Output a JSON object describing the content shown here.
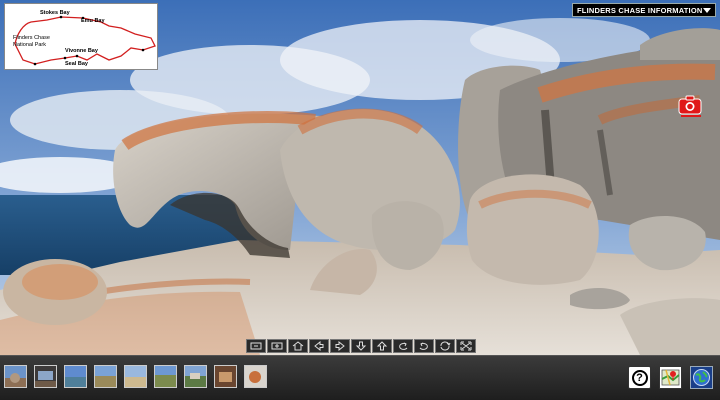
{
  "info_dropdown": {
    "label": "FLINDERS CHASE INFORMATION"
  },
  "minimap": {
    "labels": {
      "stokes_bay": "Stokes Bay",
      "emu_bay": "Emu Bay",
      "park_line1": "Flinders Chase",
      "park_line2": "National Park",
      "vivonne_bay": "Vivonne Bay",
      "seal_bay": "Seal Bay"
    }
  },
  "navbar": {
    "buttons": [
      "zoom-out",
      "zoom-in",
      "home",
      "pan-left",
      "pan-right",
      "pan-down",
      "pan-up",
      "rotate-left",
      "rotate-right",
      "autorotate",
      "fullscreen"
    ]
  },
  "thumbnails": {
    "count": 9
  },
  "right_buttons": {
    "help": "?"
  },
  "colors": {
    "sky": "#4a7fc4",
    "ocean": "#1d4f7d",
    "rock": "#cfc9bf",
    "lichen": "#d2763e",
    "strip": "#2b2b2b"
  }
}
